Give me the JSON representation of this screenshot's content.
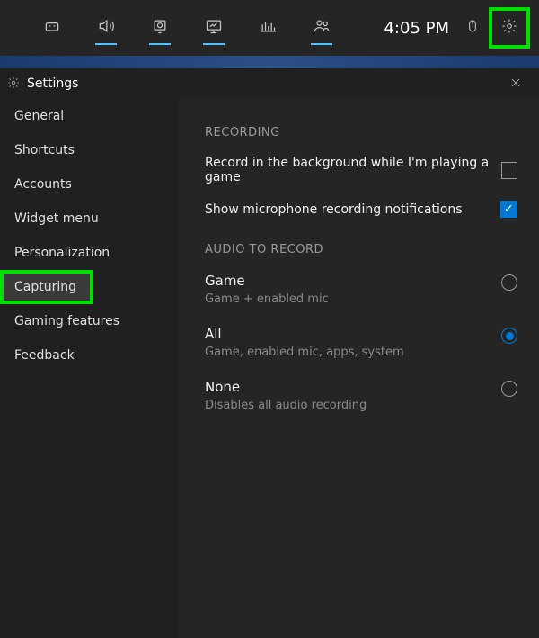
{
  "toolbar": {
    "clock": "4:05 PM",
    "icons": {
      "console": "console-icon",
      "audio": "audio-icon",
      "capture": "capture-icon",
      "monitor": "monitor-icon",
      "performance": "performance-icon",
      "social": "social-icon",
      "mouse": "mouse-icon",
      "gear": "gear-icon"
    }
  },
  "panel": {
    "title": "Settings"
  },
  "sidebar": {
    "items": [
      "General",
      "Shortcuts",
      "Accounts",
      "Widget menu",
      "Personalization",
      "Capturing",
      "Gaming features",
      "Feedback"
    ],
    "active_index": 5
  },
  "content": {
    "sections": {
      "recording": {
        "header": "RECORDING",
        "background_label": "Record in the background while I'm playing a game",
        "background_checked": false,
        "mic_notif_label": "Show microphone recording notifications",
        "mic_notif_checked": true
      },
      "audio": {
        "header": "AUDIO TO RECORD",
        "selected_index": 1,
        "options": [
          {
            "title": "Game",
            "sub": "Game + enabled mic"
          },
          {
            "title": "All",
            "sub": "Game, enabled mic, apps, system"
          },
          {
            "title": "None",
            "sub": "Disables all audio recording"
          }
        ]
      }
    }
  },
  "colors": {
    "accent": "#0078d4",
    "highlight_box": "#00e000"
  }
}
